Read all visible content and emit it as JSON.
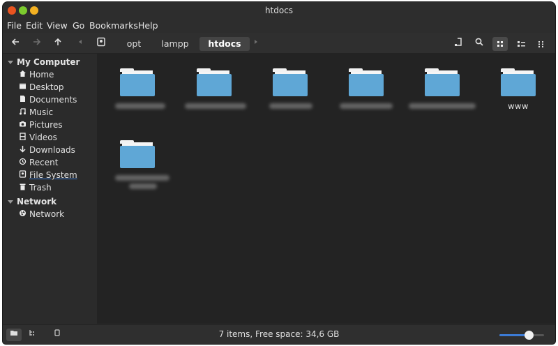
{
  "window": {
    "title": "htdocs"
  },
  "menu": [
    "File",
    "Edit",
    "View",
    "Go",
    "Bookmarks",
    "Help"
  ],
  "toolbar": {
    "breadcrumbs": [
      "opt",
      "lampp",
      "htdocs"
    ],
    "active_crumb": "htdocs",
    "icons": [
      "back-arrow-icon",
      "forward-arrow-icon",
      "up-arrow-icon",
      "path-left-icon",
      "drive-icon",
      "path-right-icon",
      "edit-path-icon",
      "search-icon",
      "icon-view-icon",
      "list-view-icon",
      "compact-view-icon"
    ]
  },
  "sidebar": {
    "sections": [
      {
        "title": "My Computer",
        "items": [
          {
            "label": "Home",
            "icon": "home-icon"
          },
          {
            "label": "Desktop",
            "icon": "desktop-icon"
          },
          {
            "label": "Documents",
            "icon": "documents-icon"
          },
          {
            "label": "Music",
            "icon": "music-icon"
          },
          {
            "label": "Pictures",
            "icon": "pictures-icon"
          },
          {
            "label": "Videos",
            "icon": "videos-icon"
          },
          {
            "label": "Downloads",
            "icon": "downloads-icon"
          },
          {
            "label": "Recent",
            "icon": "recent-icon"
          },
          {
            "label": "File System",
            "icon": "filesystem-icon"
          },
          {
            "label": "Trash",
            "icon": "trash-icon"
          }
        ]
      },
      {
        "title": "Network",
        "items": [
          {
            "label": "Network",
            "icon": "network-icon"
          }
        ]
      }
    ]
  },
  "files": [
    {
      "name": "",
      "blurred": true
    },
    {
      "name": "",
      "blurred": true
    },
    {
      "name": "",
      "blurred": true
    },
    {
      "name": "",
      "blurred": true
    },
    {
      "name": "",
      "blurred": true
    },
    {
      "name": "www",
      "blurred": false
    },
    {
      "name": "",
      "blurred": true
    }
  ],
  "status": {
    "text": "7 items, Free space: 34,6 GB",
    "zoom_level": 0.65
  },
  "colors": {
    "accent": "#3c7bd5",
    "folder": "#5fa7d6",
    "close_button": "#e95420",
    "minimize_button": "#7ccb2e",
    "maximize_button": "#f4b122"
  }
}
